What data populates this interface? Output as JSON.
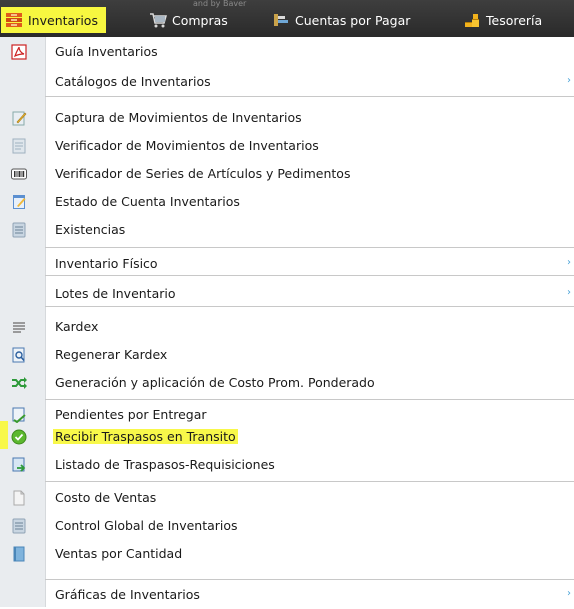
{
  "topbar": {
    "ghost_text": "and by Baver",
    "tabs": [
      {
        "label": "Inventarios",
        "icon": "boxes-icon"
      },
      {
        "label": "Compras",
        "icon": "cart-icon"
      },
      {
        "label": "Cuentas por Pagar",
        "icon": "payables-icon"
      },
      {
        "label": "Tesorería",
        "icon": "coins-icon"
      }
    ]
  },
  "menu": {
    "items": [
      {
        "label": "Guía Inventarios",
        "icon": "pdf-icon"
      },
      {
        "label": "Catálogos de Inventarios",
        "icon": "",
        "submenu": "›"
      },
      {
        "label": "Captura de Movimientos de Inventarios",
        "icon": "edit-doc-icon"
      },
      {
        "label": "Verificador de Movimientos de Inventarios",
        "icon": "doc-icon"
      },
      {
        "label": "Verificador de Series de Artículos y Pedimentos",
        "icon": "barcode-icon"
      },
      {
        "label": "Estado de Cuenta Inventarios",
        "icon": "notepad-icon"
      },
      {
        "label": "Existencias",
        "icon": "list-icon"
      },
      {
        "label": "Inventario Físico",
        "icon": "",
        "submenu": "›"
      },
      {
        "label": "Lotes de Inventario",
        "icon": "",
        "submenu": "›"
      },
      {
        "label": "Kardex",
        "icon": "lines-icon"
      },
      {
        "label": "Regenerar Kardex",
        "icon": "doc-search-icon"
      },
      {
        "label": "Generación y aplicación de Costo Prom. Ponderado",
        "icon": "shuffle-icon"
      },
      {
        "label": "Pendientes por Entregar",
        "icon": "doc-check-icon"
      },
      {
        "label": "Recibir Traspasos en Transito",
        "icon": "green-check-icon",
        "highlight": true
      },
      {
        "label": "Listado de Traspasos-Requisiciones",
        "icon": "doc-arrow-icon"
      },
      {
        "label": "Costo de Ventas",
        "icon": "blank-doc-icon"
      },
      {
        "label": "Control Global de Inventarios",
        "icon": "list-icon"
      },
      {
        "label": "Ventas por Cantidad",
        "icon": "book-icon"
      },
      {
        "label": "Gráficas de Inventarios",
        "icon": "",
        "submenu": "›"
      }
    ]
  },
  "colors": {
    "topbar": "#333333",
    "highlight": "#f8f84a",
    "gutter": "#e9ecef",
    "submenu_arrow": "#4aa3d8"
  }
}
